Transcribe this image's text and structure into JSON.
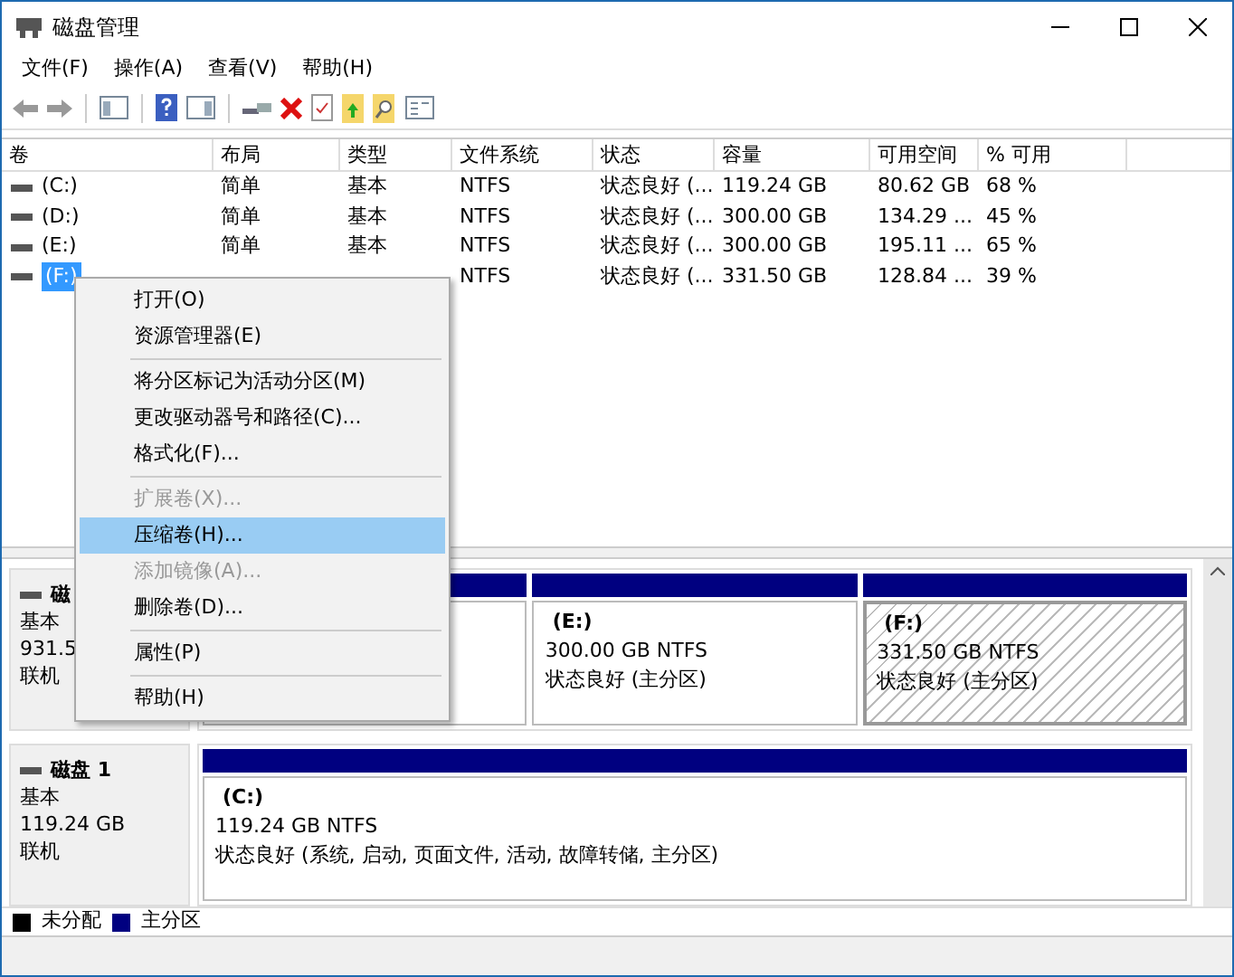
{
  "window": {
    "title": "磁盘管理"
  },
  "menu_bar": [
    "文件(F)",
    "操作(A)",
    "查看(V)",
    "帮助(H)"
  ],
  "volumes": {
    "columns": [
      "卷",
      "布局",
      "类型",
      "文件系统",
      "状态",
      "容量",
      "可用空间",
      "% 可用"
    ],
    "rows": [
      {
        "volume": "(C:)",
        "layout": "简单",
        "type": "基本",
        "file_system": "NTFS",
        "status": "状态良好 (...",
        "capacity": "119.24 GB",
        "free": "80.62 GB",
        "percent_free": "68 %",
        "selected": false
      },
      {
        "volume": "(D:)",
        "layout": "简单",
        "type": "基本",
        "file_system": "NTFS",
        "status": "状态良好 (...",
        "capacity": "300.00 GB",
        "free": "134.29 ...",
        "percent_free": "45 %",
        "selected": false
      },
      {
        "volume": "(E:)",
        "layout": "简单",
        "type": "基本",
        "file_system": "NTFS",
        "status": "状态良好 (...",
        "capacity": "300.00 GB",
        "free": "195.11 ...",
        "percent_free": "65 %",
        "selected": false
      },
      {
        "volume": "(F:)",
        "file_system": "NTFS",
        "status": "状态良好 (...",
        "capacity": "331.50 GB",
        "free": "128.84 ...",
        "percent_free": "39 %",
        "selected": true
      }
    ]
  },
  "disks": [
    {
      "name": "磁",
      "type": "基本",
      "size": "931.5",
      "status": "联机",
      "partitions": [
        {
          "selected": false
        },
        {
          "label": "(E:)",
          "size": "300.00 GB NTFS",
          "status": "状态良好 (主分区)",
          "selected": false
        },
        {
          "label": "(F:)",
          "size": "331.50 GB NTFS",
          "status": "状态良好 (主分区)",
          "selected": true
        }
      ]
    },
    {
      "name": "磁盘 1",
      "type": "基本",
      "size": "119.24 GB",
      "status": "联机",
      "partitions": [
        {
          "label": "(C:)",
          "size": "119.24 GB NTFS",
          "status": "状态良好 (系统, 启动, 页面文件, 活动, 故障转储, 主分区)",
          "selected": false
        }
      ]
    }
  ],
  "legend": [
    {
      "label": "未分配",
      "color": "#000000"
    },
    {
      "label": "主分区",
      "color": "#000080"
    }
  ],
  "context_menu": [
    {
      "kind": "item",
      "label": "打开(O)",
      "disabled": false,
      "selected": false
    },
    {
      "kind": "item",
      "label": "资源管理器(E)",
      "disabled": false,
      "selected": false
    },
    {
      "kind": "separator"
    },
    {
      "kind": "item",
      "label": "将分区标记为活动分区(M)",
      "disabled": false,
      "selected": false
    },
    {
      "kind": "item",
      "label": "更改驱动器号和路径(C)...",
      "disabled": false,
      "selected": false
    },
    {
      "kind": "item",
      "label": "格式化(F)...",
      "disabled": false,
      "selected": false
    },
    {
      "kind": "separator"
    },
    {
      "kind": "item",
      "label": "扩展卷(X)...",
      "disabled": true,
      "selected": false
    },
    {
      "kind": "item",
      "label": "压缩卷(H)...",
      "disabled": false,
      "selected": true
    },
    {
      "kind": "item",
      "label": "添加镜像(A)...",
      "disabled": true,
      "selected": false
    },
    {
      "kind": "item",
      "label": "删除卷(D)...",
      "disabled": false,
      "selected": false
    },
    {
      "kind": "separator"
    },
    {
      "kind": "item",
      "label": "属性(P)",
      "disabled": false,
      "selected": false
    },
    {
      "kind": "separator"
    },
    {
      "kind": "item",
      "label": "帮助(H)",
      "disabled": false,
      "selected": false
    }
  ]
}
